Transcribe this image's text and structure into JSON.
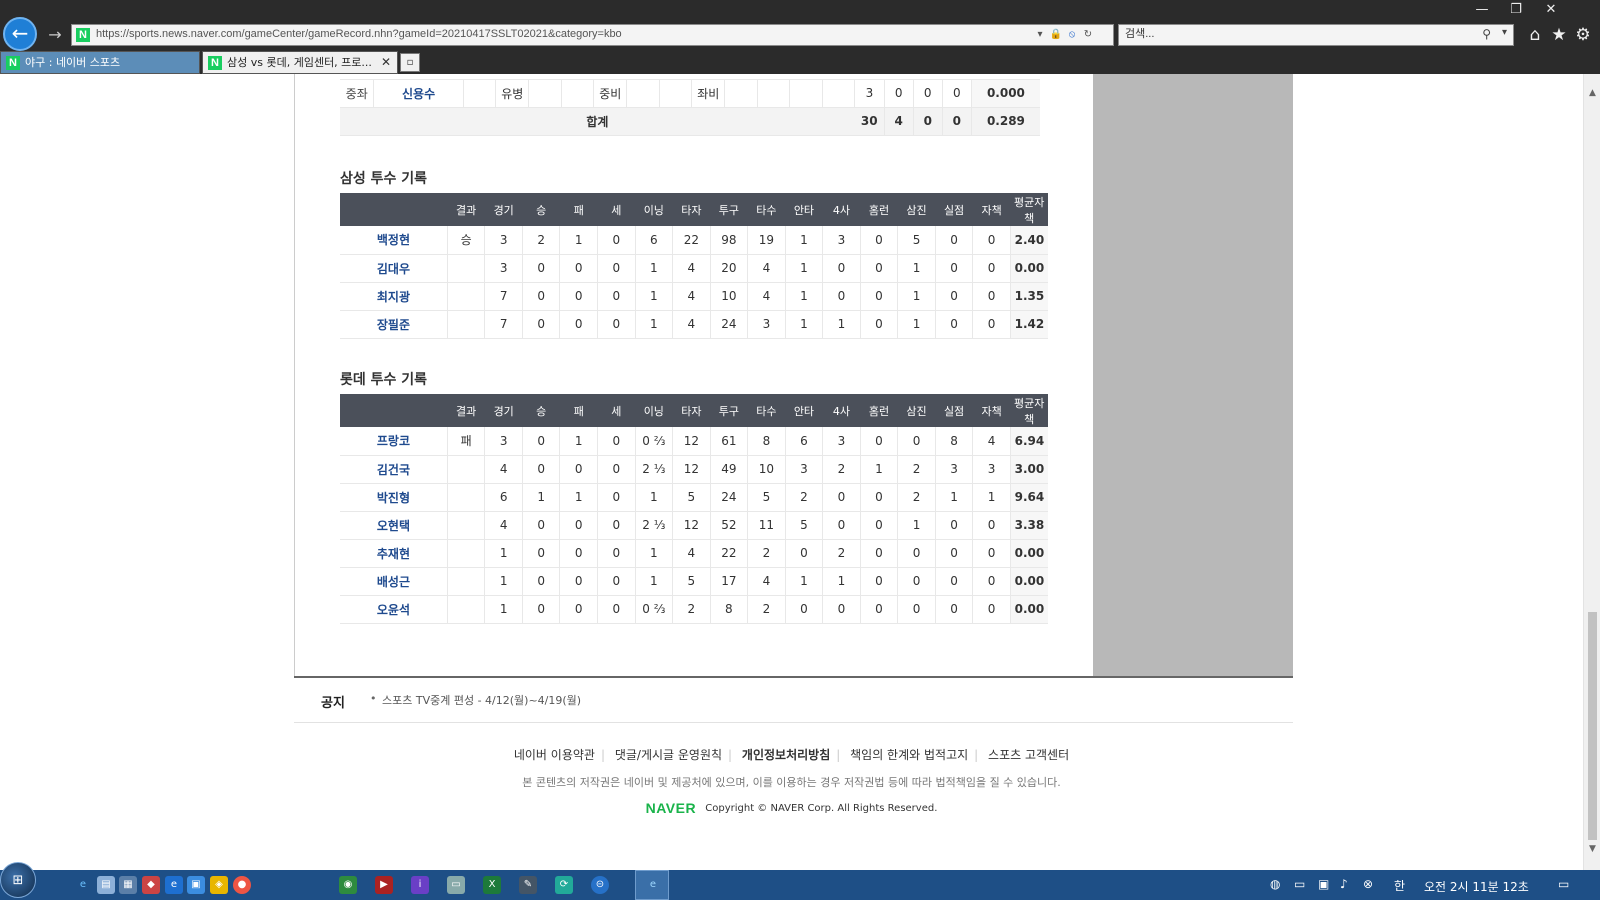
{
  "browser": {
    "url": "https://sports.news.naver.com/gameCenter/gameRecord.nhn?gameId=20210417SSLT02021&category=kbo",
    "search_placeholder": "검색...",
    "tabs": [
      {
        "label": "야구 : 네이버 스포츠"
      },
      {
        "label": "삼성 vs 롯데, 게임센터, 프로..."
      }
    ]
  },
  "batting": {
    "last_row": {
      "pos": "중좌",
      "name": "신용수",
      "inning_cells": [
        "",
        "유병",
        "",
        "",
        "중비",
        "",
        "",
        "좌비",
        "",
        "",
        "",
        ""
      ],
      "stats": [
        "3",
        "0",
        "0",
        "0",
        "0.000"
      ]
    },
    "total_row": {
      "label": "합계",
      "stats": [
        "30",
        "4",
        "0",
        "0",
        "0.289"
      ]
    }
  },
  "samsung_pitching": {
    "title": "삼성 투수 기록",
    "headers": [
      "",
      "결과",
      "경기",
      "승",
      "패",
      "세",
      "이닝",
      "타자",
      "투구",
      "타수",
      "안타",
      "4사",
      "홈런",
      "삼진",
      "실점",
      "자책",
      "평균자책"
    ],
    "rows": [
      {
        "name": "백정현",
        "cells": [
          "승",
          "3",
          "2",
          "1",
          "0",
          "6",
          "22",
          "98",
          "19",
          "1",
          "3",
          "0",
          "5",
          "0",
          "0",
          "2.40"
        ]
      },
      {
        "name": "김대우",
        "cells": [
          "",
          "3",
          "0",
          "0",
          "0",
          "1",
          "4",
          "20",
          "4",
          "1",
          "0",
          "0",
          "1",
          "0",
          "0",
          "0.00"
        ]
      },
      {
        "name": "최지광",
        "cells": [
          "",
          "7",
          "0",
          "0",
          "0",
          "1",
          "4",
          "10",
          "4",
          "1",
          "0",
          "0",
          "1",
          "0",
          "0",
          "1.35"
        ]
      },
      {
        "name": "장필준",
        "cells": [
          "",
          "7",
          "0",
          "0",
          "0",
          "1",
          "4",
          "24",
          "3",
          "1",
          "1",
          "0",
          "1",
          "0",
          "0",
          "1.42"
        ]
      }
    ]
  },
  "lotte_pitching": {
    "title": "롯데 투수 기록",
    "headers": [
      "",
      "결과",
      "경기",
      "승",
      "패",
      "세",
      "이닝",
      "타자",
      "투구",
      "타수",
      "안타",
      "4사",
      "홈런",
      "삼진",
      "실점",
      "자책",
      "평균자책"
    ],
    "rows": [
      {
        "name": "프랑코",
        "cells": [
          "패",
          "3",
          "0",
          "1",
          "0",
          "0 ⅔",
          "12",
          "61",
          "8",
          "6",
          "3",
          "0",
          "0",
          "8",
          "4",
          "6.94"
        ]
      },
      {
        "name": "김건국",
        "cells": [
          "",
          "4",
          "0",
          "0",
          "0",
          "2 ⅓",
          "12",
          "49",
          "10",
          "3",
          "2",
          "1",
          "2",
          "3",
          "3",
          "3.00"
        ]
      },
      {
        "name": "박진형",
        "cells": [
          "",
          "6",
          "1",
          "1",
          "0",
          "1",
          "5",
          "24",
          "5",
          "2",
          "0",
          "0",
          "2",
          "1",
          "1",
          "9.64"
        ]
      },
      {
        "name": "오현택",
        "cells": [
          "",
          "4",
          "0",
          "0",
          "0",
          "2 ⅓",
          "12",
          "52",
          "11",
          "5",
          "0",
          "0",
          "1",
          "0",
          "0",
          "3.38"
        ]
      },
      {
        "name": "추재현",
        "cells": [
          "",
          "1",
          "0",
          "0",
          "0",
          "1",
          "4",
          "22",
          "2",
          "0",
          "2",
          "0",
          "0",
          "0",
          "0",
          "0.00"
        ]
      },
      {
        "name": "배성근",
        "cells": [
          "",
          "1",
          "0",
          "0",
          "0",
          "1",
          "5",
          "17",
          "4",
          "1",
          "1",
          "0",
          "0",
          "0",
          "0",
          "0.00"
        ]
      },
      {
        "name": "오윤석",
        "cells": [
          "",
          "1",
          "0",
          "0",
          "0",
          "0 ⅔",
          "2",
          "8",
          "2",
          "0",
          "0",
          "0",
          "0",
          "0",
          "0",
          "0.00"
        ]
      }
    ]
  },
  "notice": {
    "label": "공지",
    "text": "스포츠 TV중계 편성 - 4/12(월)~4/19(월)"
  },
  "footer": {
    "links": [
      "네이버 이용약관",
      "댓글/게시글 운영원칙",
      "개인정보처리방침",
      "책임의 한계와 법적고지",
      "스포츠 고객센터"
    ],
    "note": "본 콘텐츠의 저작권은 네이버 및 제공처에 있으며, 이를 이용하는 경우 저작권법 등에 따라 법적책임을 질 수 있습니다.",
    "logo": "NAVER",
    "copyright": "Copyright © NAVER Corp.  All Rights Reserved."
  },
  "taskbar": {
    "clock": "오전 2시 11분 12초"
  },
  "colors": {
    "header_bg": "#4b505a",
    "player_link": "#1f4a8e",
    "naver_green": "#19b34a",
    "taskbar": "#1e4f86"
  }
}
